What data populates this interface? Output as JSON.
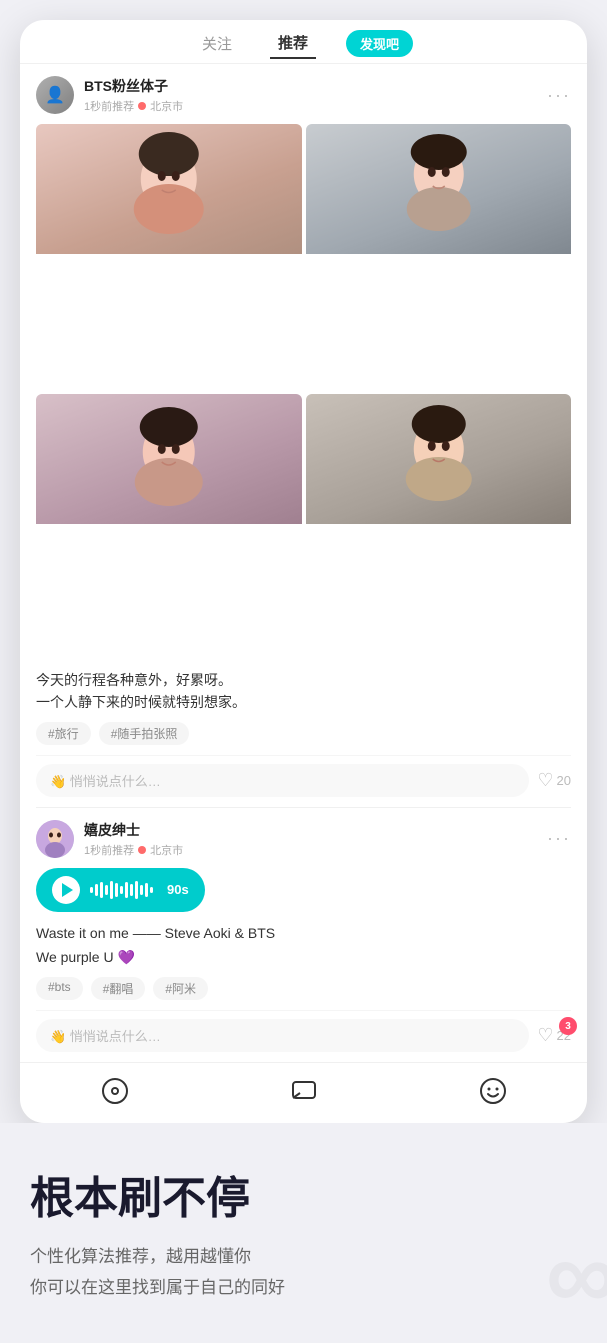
{
  "tabs": {
    "guanzhu": "关注",
    "tuijian": "推荐",
    "active": "推荐",
    "discover": "发现吧"
  },
  "post1": {
    "username": "BTS粉丝体子",
    "time": "1秒前推荐",
    "location": "北京市",
    "text_line1": "今天的行程各种意外，好累呀。",
    "text_line2": "一个人静下来的时候就特别想家。",
    "tags": [
      "#旅行",
      "#随手拍张照"
    ],
    "comment_placeholder": "👋 悄悄说点什么…",
    "like_count": "20"
  },
  "post2": {
    "username": "嬉皮绅士",
    "time": "1秒前推荐",
    "location": "北京市",
    "audio_duration": "90s",
    "text_line1": "Waste it on me —— Steve Aoki & BTS",
    "text_line2": "We purple U",
    "purple_heart": "💜",
    "tags": [
      "#bts",
      "#翻唱",
      "#阿米"
    ],
    "comment_placeholder": "👋 悄悄说点什么…",
    "like_count": "22",
    "like_badge": "3"
  },
  "bottom_nav": {
    "discover": "🔍",
    "message": "💬",
    "emoji": "😊"
  },
  "marketing": {
    "title": "根本刷不停",
    "desc_line1": "个性化算法推荐，越用越懂你",
    "desc_line2": "你可以在这里找到属于自己的同好",
    "watermark": "∞"
  }
}
